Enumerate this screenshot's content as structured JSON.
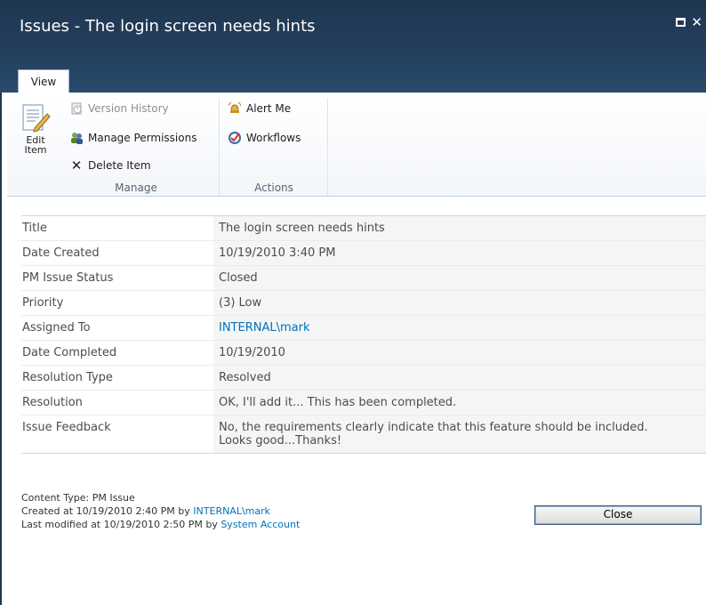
{
  "window": {
    "title": "Issues - The login screen needs hints"
  },
  "tabs": [
    {
      "label": "View"
    }
  ],
  "ribbon": {
    "edit_item_line1": "Edit",
    "edit_item_line2": "Item",
    "version_history": "Version History",
    "manage_permissions": "Manage Permissions",
    "delete_item": "Delete Item",
    "manage_group": "Manage",
    "alert_me": "Alert Me",
    "workflows": "Workflows",
    "actions_group": "Actions"
  },
  "fields": [
    {
      "label": "Title",
      "value": "The login screen needs hints"
    },
    {
      "label": "Date Created",
      "value": "10/19/2010 3:40 PM"
    },
    {
      "label": "PM Issue Status",
      "value": "Closed"
    },
    {
      "label": "Priority",
      "value": "(3) Low"
    },
    {
      "label": "Assigned To",
      "value": "INTERNAL\\mark"
    },
    {
      "label": "Date Completed",
      "value": "10/19/2010"
    },
    {
      "label": "Resolution Type",
      "value": "Resolved"
    },
    {
      "label": "Resolution",
      "value": "OK, I'll add it... This has been completed."
    },
    {
      "label": "Issue Feedback",
      "value_line1": "No, the requirements clearly indicate that this feature should be included.",
      "value_line2": "Looks good...Thanks!"
    }
  ],
  "footer": {
    "content_type": "Content Type: PM Issue",
    "created_prefix": "Created at 10/19/2010 2:40 PM by ",
    "created_by": "INTERNAL\\mark",
    "modified_prefix": "Last modified at 10/19/2010 2:50 PM by ",
    "modified_by": "System Account"
  },
  "buttons": {
    "close": "Close"
  },
  "colors": {
    "titlebar": "#23405e",
    "link": "#0072bc"
  }
}
